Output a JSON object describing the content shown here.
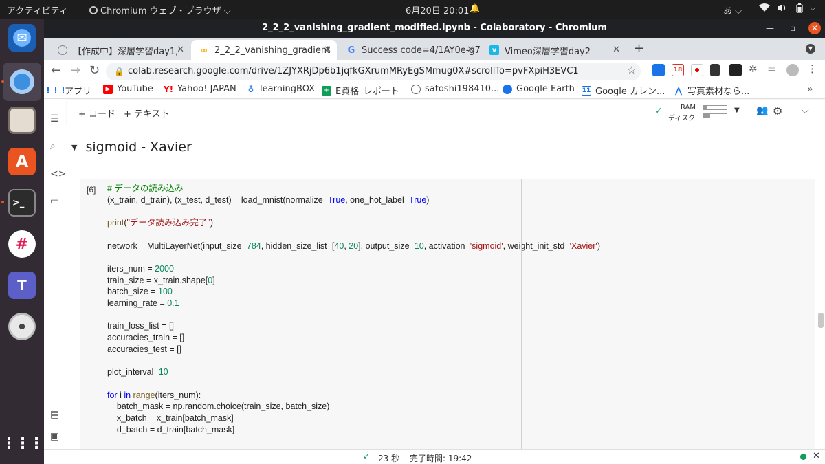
{
  "system_bar": {
    "activities": "アクティビティ",
    "app_menu": "Chromium ウェブ・ブラウザ ⌵",
    "clock": "6月20日  20:01",
    "input_method": "あ ⌵"
  },
  "window": {
    "title": "2_2_2_vanishing_gradient_modified.ipynb - Colaboratory - Chromium"
  },
  "tabs": [
    {
      "label": "【作成中】深層学習day1,",
      "favicon": "page-icon",
      "active": false
    },
    {
      "label": "2_2_2_vanishing_gradient",
      "favicon": "colab-icon",
      "active": true
    },
    {
      "label": "Success code=4/1AY0e-g7",
      "favicon": "google-icon",
      "active": false
    },
    {
      "label": "Vimeo深層学習day2",
      "favicon": "vimeo-icon",
      "active": false
    }
  ],
  "address_bar": {
    "url": "colab.research.google.com/drive/1ZJYXRjDp6b1jqfkGXrumMRyEgSMmug0X#scrollTo=pvFXpiH3EVC1"
  },
  "extensions": {
    "gmail_badge": "18"
  },
  "bookmarks": [
    {
      "label": "アプリ",
      "icon": "apps-grid-icon"
    },
    {
      "label": "YouTube",
      "icon": "youtube-icon"
    },
    {
      "label": "Yahoo! JAPAN",
      "icon": "yahoo-icon"
    },
    {
      "label": "learningBOX",
      "icon": "learningbox-icon"
    },
    {
      "label": "E資格_レポート",
      "icon": "sheets-icon"
    },
    {
      "label": "satoshi198410...",
      "icon": "github-icon"
    },
    {
      "label": "Google Earth",
      "icon": "earth-icon"
    },
    {
      "label": "Google カレン...",
      "icon": "calendar-icon"
    },
    {
      "label": "写真素材なら...",
      "icon": "photo-icon"
    }
  ],
  "colab": {
    "add_code": "+ コード",
    "add_text": "+ テキスト",
    "ram_label": "RAM",
    "disk_label": "ディスク",
    "ram_fraction": 0.15,
    "disk_fraction": 0.3,
    "section_title": "sigmoid - Xavier",
    "cell_exec_count": "[6]",
    "status_time": "23 秒",
    "status_done": "完了時間: 19:42"
  },
  "code_lines": [
    "# データの読み込み",
    "(x_train, d_train), (x_test, d_test) = load_mnist(normalize=True, one_hot_label=True)",
    "",
    "print(\"データ読み込み完了\")",
    "",
    "network = MultiLayerNet(input_size=784, hidden_size_list=[40, 20], output_size=10, activation='sigmoid', weight_init_std='Xavier')",
    "",
    "iters_num = 2000",
    "train_size = x_train.shape[0]",
    "batch_size = 100",
    "learning_rate = 0.1",
    "",
    "train_loss_list = []",
    "accuracies_train = []",
    "accuracies_test = []",
    "",
    "plot_interval=10",
    "",
    "for i in range(iters_num):",
    "    batch_mask = np.random.choice(train_size, batch_size)",
    "    x_batch = x_train[batch_mask]",
    "    d_batch = d_train[batch_mask]"
  ],
  "colors": {
    "comment": "#008000",
    "number": "#098658",
    "keyword": "#0000ff",
    "string": "#a31515",
    "builtin": "#795e26",
    "dock_bg": "#322b33"
  }
}
